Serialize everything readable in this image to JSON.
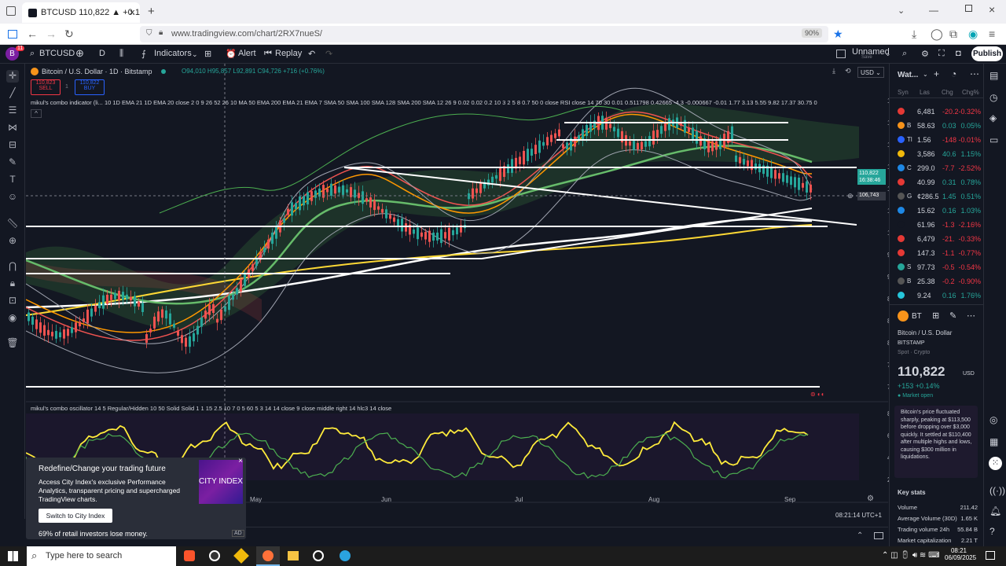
{
  "browser": {
    "tab_title": "BTCUSD 110,822 ▲ +0.14% Un",
    "url": "www.tradingview.com/chart/2RX7nueS/",
    "zoom": "90%"
  },
  "toolbar": {
    "symbol": "BTCUSD",
    "interval": "D",
    "indicators": "Indicators",
    "alert": "Alert",
    "replay": "Replay",
    "layout_name": "Unnamed",
    "layout_status": "Save",
    "publish": "Publish",
    "avatar_letter": "B",
    "notif": "11"
  },
  "chart": {
    "title": "Bitcoin / U.S. Dollar · 1D · Bitstamp",
    "ohlc": "O94,010 H95,857 L92,891 C94,726 +716 (+0.76%)",
    "sell_price": "110,823",
    "sell_label": "SELL",
    "buy_price": "110,822",
    "buy_label": "BUY",
    "spread": "1",
    "indicator1": "mikul's combo indicator (li... 10 1D EMA 21 1D EMA 20 close 2 0 9 26 52 26 10 MA 50 EMA 200 EMA 21 EMA 7 SMA 50 SMA 100 SMA 128 SMA 200 SMA 12 26 9 0.02 0.02 0.2 10 3 2 5 8 0.7 50 0 close RSI close 14 70 30 0.01 0.511798 0.42665 -4.3 -0.000667 -0.01 1.77 3.13 5.55 9.82 17.37 30.75 0",
    "indicator2": "mikul's combo oscillator 14 5 Regular/Hidden 10 50 Solid Solid 1 1 15 2.5 10 7 0 5 60 5 3 14 14 close 9 close middle right 14 hlc3 14 close",
    "currency": "USD",
    "price_label": "110,822",
    "countdown": "16:38:46",
    "crosshair_price": "106,743",
    "price_ticks": [
      "124,000",
      "120,000",
      "116,000",
      "112,000",
      "108,000",
      "104,000",
      "100,000",
      "96,000",
      "92,000",
      "88,000",
      "84,000",
      "80,000",
      "76,000",
      "72,000"
    ],
    "osc_ticks": [
      "80.00",
      "60.00",
      "40.00",
      "20.00"
    ],
    "months": [
      "May",
      "Jun",
      "Jul",
      "Aug",
      "Sep"
    ],
    "time": "08:21:14 UTC+1"
  },
  "watchlist": {
    "header": "Wat...",
    "cols": [
      "Syn",
      "Las",
      "Chg",
      "Chg%"
    ],
    "rows": [
      {
        "sym": "",
        "last": "6,481",
        "chg": "-20.2",
        "pct": "-0.32%",
        "color": "#e53935"
      },
      {
        "sym": "B",
        "last": "58.63",
        "chg": "0.03",
        "pct": "0.05%",
        "color": "#f7931a"
      },
      {
        "sym": "Tl",
        "last": "1.56",
        "chg": "-148",
        "pct": "-0.01%",
        "color": "#2962ff"
      },
      {
        "sym": "",
        "last": "3,586",
        "chg": "40.6",
        "pct": "1.15%",
        "color": "#f0b90b"
      },
      {
        "sym": "C",
        "last": "299.0",
        "chg": "-7.7",
        "pct": "-2.52%",
        "color": "#1e88e5"
      },
      {
        "sym": "",
        "last": "40.99",
        "chg": "0.31",
        "pct": "0.78%",
        "color": "#e53935"
      },
      {
        "sym": "G",
        "last": "¢286.5",
        "chg": "1.45",
        "pct": "0.51%",
        "color": "#555"
      },
      {
        "sym": "",
        "last": "15.62",
        "chg": "0.16",
        "pct": "1.03%",
        "color": "#1e88e5"
      },
      {
        "sym": "",
        "last": "61.96",
        "chg": "-1.3",
        "pct": "-2.16%",
        "color": "#131722"
      },
      {
        "sym": "",
        "last": "6,479",
        "chg": "-21.",
        "pct": "-0.33%",
        "color": "#e53935"
      },
      {
        "sym": "",
        "last": "147.3",
        "chg": "-1.1",
        "pct": "-0.77%",
        "color": "#e53935"
      },
      {
        "sym": "S",
        "last": "97.73",
        "chg": "-0.5",
        "pct": "-0.54%",
        "color": "#26a69a"
      },
      {
        "sym": "B",
        "last": "25.38",
        "chg": "-0.2",
        "pct": "-0.90%",
        "color": "#555"
      },
      {
        "sym": "",
        "last": "9.24",
        "chg": "0.16",
        "pct": "1.76%",
        "color": "#26c6da"
      }
    ]
  },
  "details": {
    "sym": "BT",
    "name": "Bitcoin / U.S. Dollar",
    "exchange": "BITSTAMP",
    "type": "Spot · Crypto",
    "price": "110,822",
    "currency": "USD",
    "change": "+153 +0.14%",
    "status": "Market open",
    "news": "Bitcoin's price fluctuated sharply, peaking at $113,500 before dropping over $3,000 quickly. It settled at $110,400 after multiple highs and lows, causing $300 million in liquidations.",
    "key_stats": "Key stats",
    "stats": [
      {
        "label": "Volume",
        "value": "211.42"
      },
      {
        "label": "Average Volume (30D)",
        "value": "1.65 K"
      },
      {
        "label": "Trading volume 24h",
        "value": "55.84 B"
      },
      {
        "label": "Market capitalization",
        "value": "2.21 T"
      }
    ]
  },
  "ad": {
    "title": "Redefine/Change your trading future",
    "body": "Access City Index's exclusive Performance Analytics, transparent pricing and supercharged TradingView charts.",
    "button": "Switch to City Index",
    "brand": "CITY INDEX",
    "risk": "69% of retail investors lose money.",
    "ad_label": "AD"
  },
  "taskbar": {
    "search": "Type here to search",
    "time": "08:21",
    "date": "06/09/2025"
  }
}
